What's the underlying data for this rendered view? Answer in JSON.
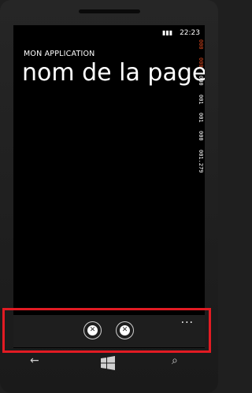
{
  "status": {
    "time": "22:23",
    "battery_icon": "battery-icon"
  },
  "header": {
    "app_title": "MON APPLICATION",
    "page_title": "nom de la page"
  },
  "debug_counters": [
    "000",
    "000",
    "000",
    "001",
    "001",
    "000",
    "001.279"
  ],
  "appbar": {
    "buttons": [
      {
        "icon": "close-circle-icon",
        "glyph": "✕"
      },
      {
        "icon": "close-circle-icon",
        "glyph": "✕"
      }
    ],
    "more_label": "..."
  },
  "nav": {
    "back_glyph": "←",
    "search_glyph": "⌕"
  },
  "colors": {
    "highlight": "#e21b23",
    "counters_red": "#e04a1f"
  }
}
